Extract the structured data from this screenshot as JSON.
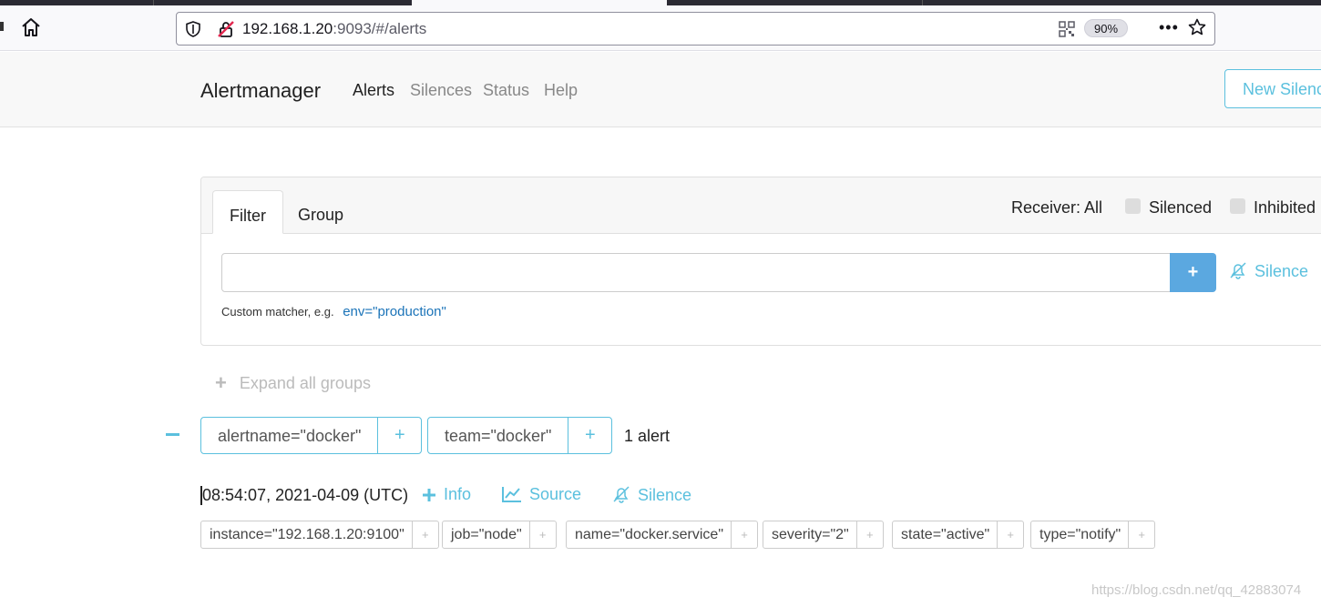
{
  "browser": {
    "url_host": "192.168.1.20",
    "url_rest": ":9093/#/alerts",
    "zoom": "90%"
  },
  "nav": {
    "brand": "Alertmanager",
    "links": [
      "Alerts",
      "Silences",
      "Status",
      "Help"
    ],
    "active": "Alerts",
    "new_silence": "New Silence"
  },
  "filter": {
    "tabs": [
      "Filter",
      "Group"
    ],
    "active_tab": "Filter",
    "receiver": "Receiver: All",
    "silenced_label": "Silenced",
    "inhibited_label": "Inhibited",
    "input_value": "",
    "add_label": "+",
    "silence_label": "Silence",
    "helper_text": "Custom matcher, e.g.",
    "helper_example": "env=\"production\""
  },
  "expand_all": "Expand all groups",
  "group": {
    "matchers": [
      "alertname=\"docker\"",
      "team=\"docker\""
    ],
    "count": "1 alert"
  },
  "alert": {
    "time": "08:54:07, 2021-04-09 (UTC)",
    "info": "Info",
    "source": "Source",
    "silence": "Silence",
    "labels": [
      "instance=\"192.168.1.20:9100\"",
      "job=\"node\"",
      "name=\"docker.service\"",
      "severity=\"2\"",
      "state=\"active\"",
      "type=\"notify\""
    ]
  },
  "watermark": "https://blog.csdn.net/qq_42883074",
  "colors": {
    "accent": "#5bc0de",
    "primary_button": "#5ba8e0"
  }
}
